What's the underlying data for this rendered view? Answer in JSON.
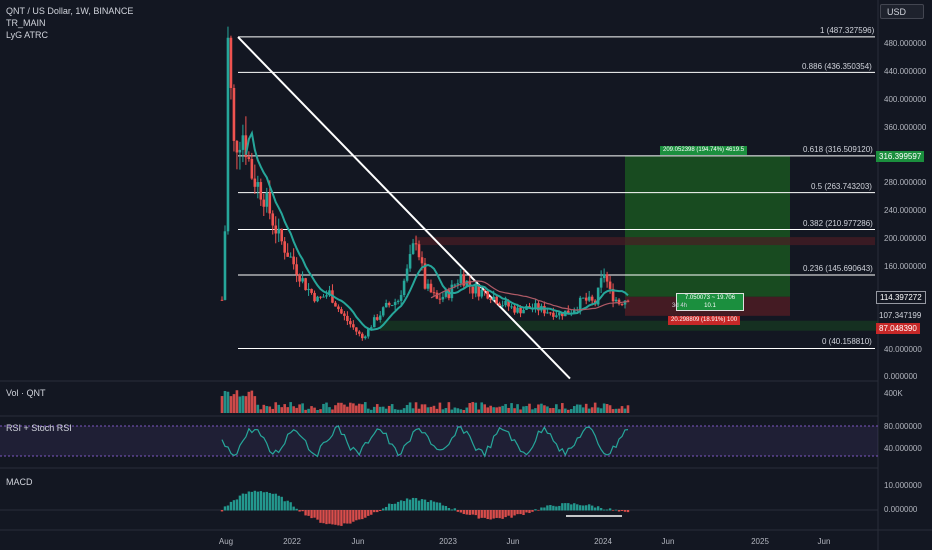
{
  "header": {
    "symbol": "QNT / US Dollar, 1W, BINANCE",
    "indicator1": "TR_MAIN",
    "indicator2": "LyG ATRC",
    "currency_button": "USD"
  },
  "panes": {
    "volume_label": "Vol · QNT",
    "volume_axis": "400K",
    "rsi_label": "RSI + Stoch RSI",
    "rsi_axis": [
      "80.000000",
      "40.000000"
    ],
    "macd_label": "MACD",
    "macd_axis": [
      "10.000000",
      "0.000000"
    ]
  },
  "fib_levels": [
    {
      "ratio": "1",
      "label": "1 (487.327596)",
      "value": 487.327596
    },
    {
      "ratio": "0.886",
      "label": "0.886 (436.350354)",
      "value": 436.350354
    },
    {
      "ratio": "0.618",
      "label": "0.618 (316.509120)",
      "value": 316.50912
    },
    {
      "ratio": "0.5",
      "label": "0.5 (263.743203)",
      "value": 263.743203
    },
    {
      "ratio": "0.382",
      "label": "0.382 (210.977286)",
      "value": 210.977286
    },
    {
      "ratio": "0.236",
      "label": "0.236 (145.690643)",
      "value": 145.690643
    },
    {
      "ratio": "0",
      "label": "0 (40.158810)",
      "value": 40.15881
    }
  ],
  "position": {
    "target_label": "209.052398 (194.74%) 4619.5",
    "center_label_line1": "7.050073 ~ 19.706",
    "center_label_line2": "3d 4h",
    "center_label_line3": "10.1",
    "stop_label": "20.298809 (18.91%) 100"
  },
  "price_tags": {
    "target": "316.399597",
    "current": "114.397272",
    "current_sub": "107.347199",
    "stop": "87.048390"
  },
  "colors": {
    "up": "#26a69a",
    "down": "#ef5350",
    "profit_zone": "#1b5e20",
    "loss_zone": "#4a1c24",
    "ma": "#26a69a",
    "slow_ma": "#b05a66",
    "rsi_line": "#26a69a",
    "rsi_band": "#7e57c2",
    "fib_line": "#ffffff"
  },
  "chart_data": {
    "type": "candlestick",
    "title": "QNT / US Dollar, 1W, BINANCE",
    "xlabel": "",
    "ylabel": "",
    "y_ticks": [
      "480.000000",
      "440.000000",
      "400.000000",
      "360.000000",
      "320.000000",
      "280.000000",
      "240.000000",
      "200.000000",
      "160.000000",
      "40.000000",
      "0.000000"
    ],
    "x_ticks": [
      "Aug",
      "2022",
      "Jun",
      "2023",
      "Jun",
      "2024",
      "Jun",
      "2025",
      "Jun"
    ],
    "ylim": [
      0,
      510
    ],
    "price_path": [
      [
        "2021-07-26",
        110
      ],
      [
        "2021-08-02",
        210
      ],
      [
        "2021-08-09",
        480
      ],
      [
        "2021-08-23",
        330
      ],
      [
        "2021-09-13",
        350
      ],
      [
        "2021-10-04",
        290
      ],
      [
        "2021-11-01",
        260
      ],
      [
        "2021-12-06",
        200
      ],
      [
        "2022-01-03",
        170
      ],
      [
        "2022-02-07",
        130
      ],
      [
        "2022-03-07",
        110
      ],
      [
        "2022-04-04",
        120
      ],
      [
        "2022-05-02",
        90
      ],
      [
        "2022-05-30",
        70
      ],
      [
        "2022-06-20",
        55
      ],
      [
        "2022-07-18",
        80
      ],
      [
        "2022-08-15",
        100
      ],
      [
        "2022-09-12",
        110
      ],
      [
        "2022-10-03",
        150
      ],
      [
        "2022-10-24",
        200
      ],
      [
        "2022-11-14",
        130
      ],
      [
        "2022-12-12",
        110
      ],
      [
        "2023-01-09",
        120
      ],
      [
        "2023-02-06",
        145
      ],
      [
        "2023-03-06",
        125
      ],
      [
        "2023-04-10",
        120
      ],
      [
        "2023-05-15",
        105
      ],
      [
        "2023-06-19",
        95
      ],
      [
        "2023-07-24",
        100
      ],
      [
        "2023-08-21",
        95
      ],
      [
        "2023-09-25",
        90
      ],
      [
        "2023-10-23",
        95
      ],
      [
        "2023-11-20",
        110
      ],
      [
        "2023-12-18",
        105
      ],
      [
        "2024-01-08",
        150
      ],
      [
        "2024-01-22",
        120
      ],
      [
        "2024-02-12",
        106
      ],
      [
        "2024-03-04",
        114
      ]
    ],
    "fib_anchor_high": 487.327596,
    "fib_anchor_low": 40.15881
  }
}
